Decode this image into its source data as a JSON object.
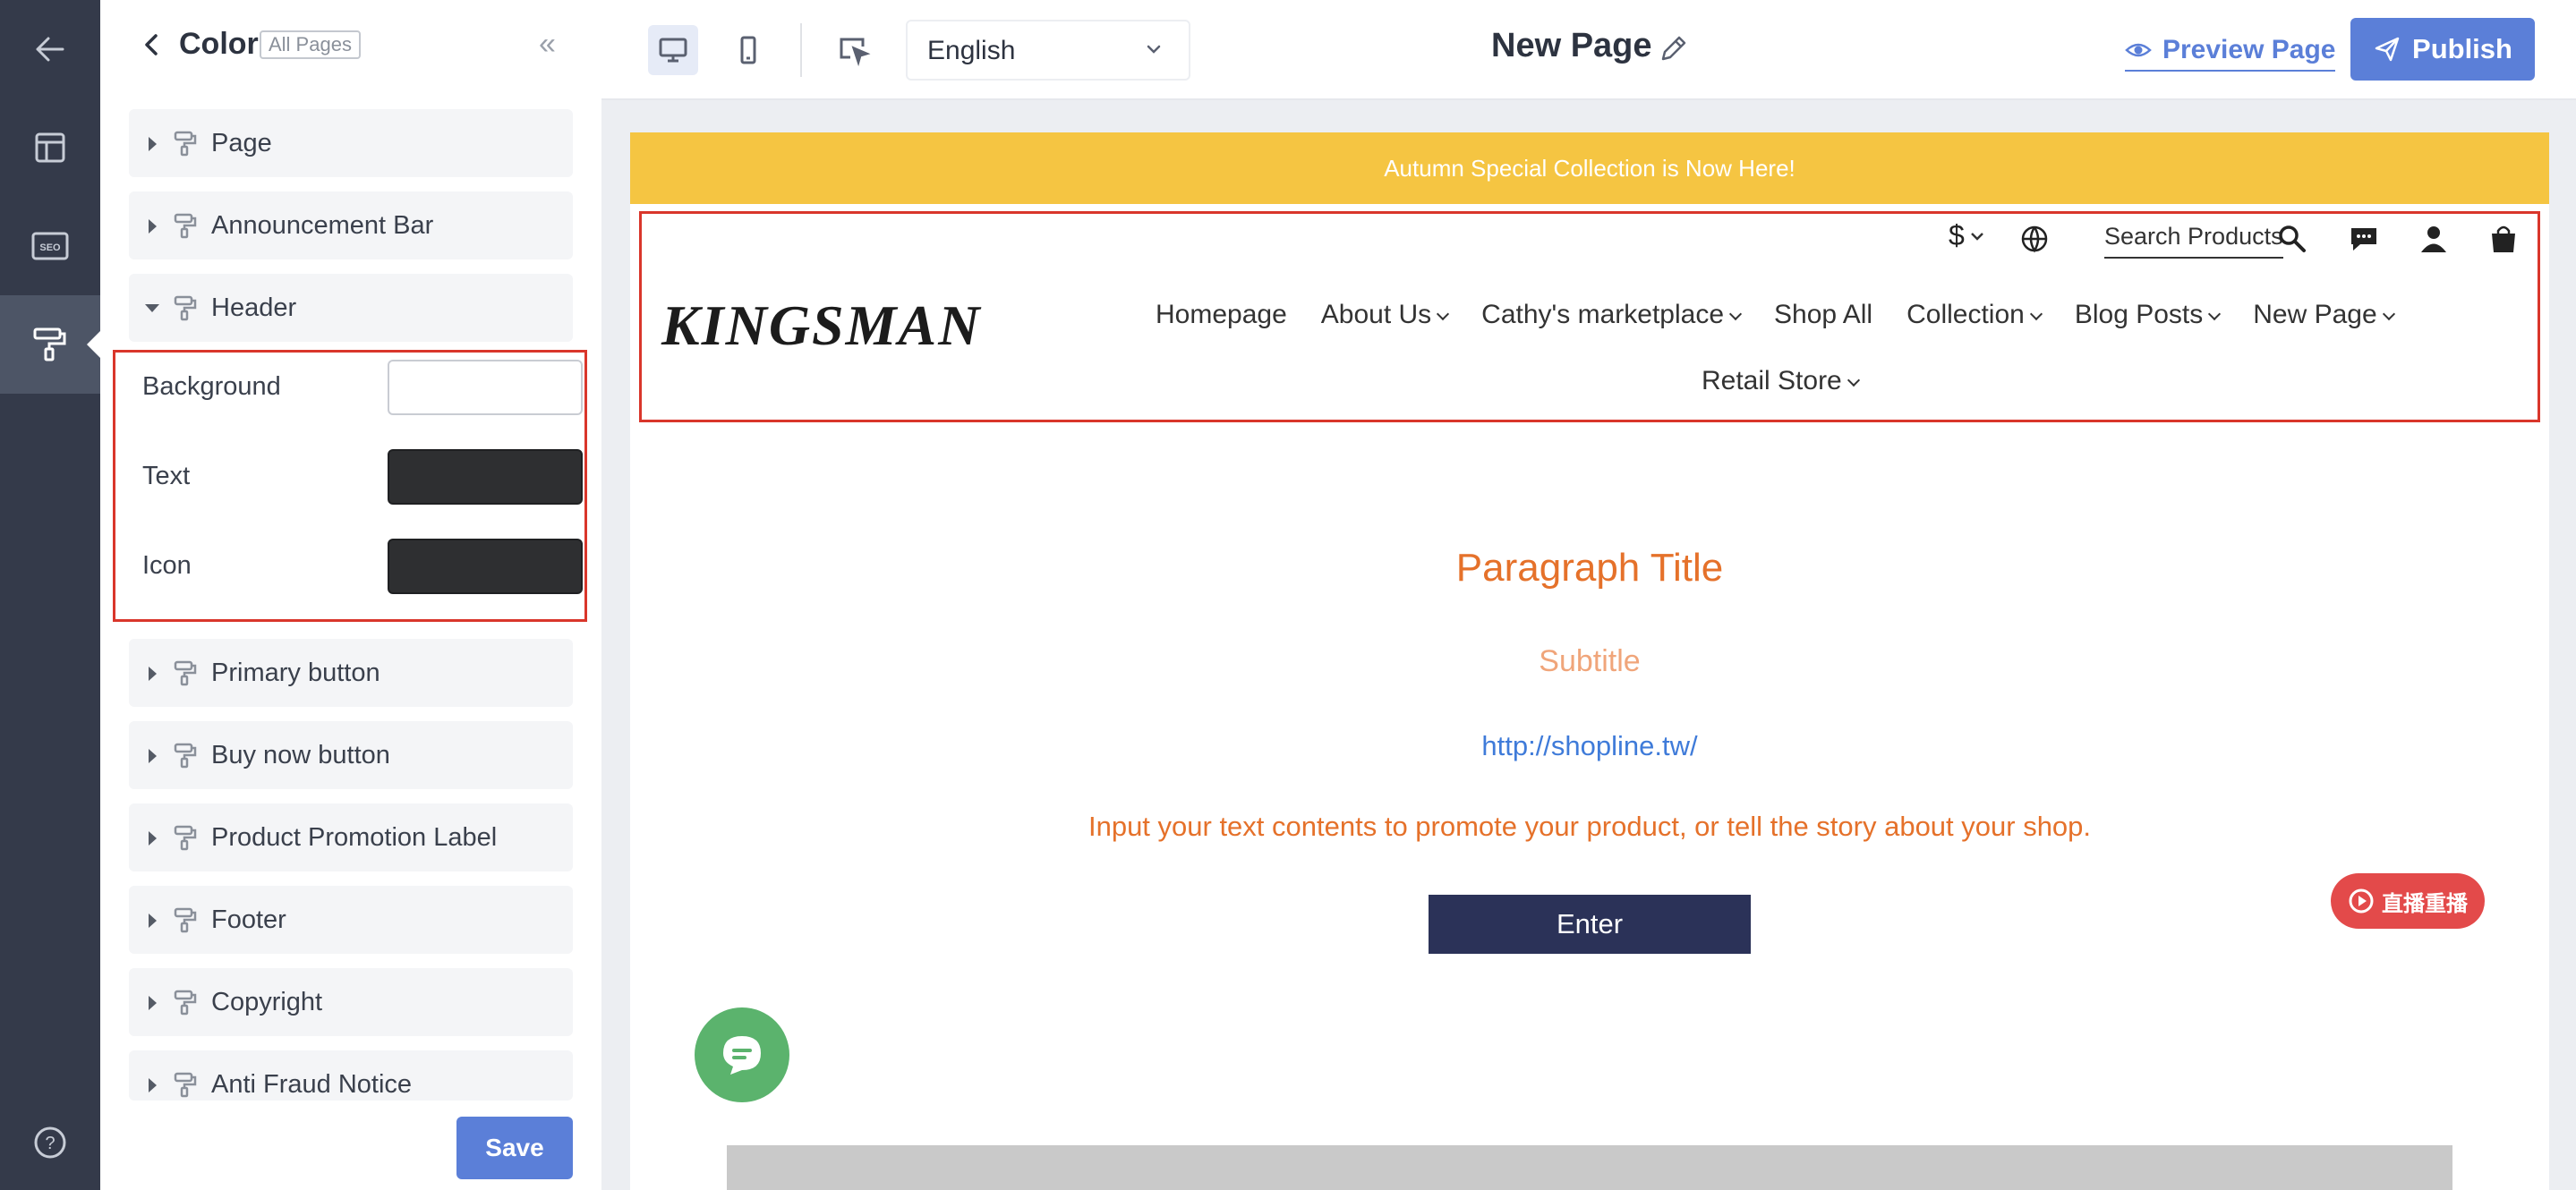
{
  "rail": {
    "items": [
      {
        "icon": "arrow-left-icon"
      },
      {
        "icon": "layout-icon"
      },
      {
        "icon": "seo-icon",
        "label": "SEO"
      },
      {
        "icon": "paint-roller-icon"
      },
      {
        "icon": "help-icon",
        "label": "?"
      }
    ]
  },
  "panel": {
    "title": "Color",
    "badge": "All Pages",
    "sections_top": [
      {
        "label": "Page"
      },
      {
        "label": "Announcement Bar"
      }
    ],
    "header_section": {
      "label": "Header",
      "rows": [
        {
          "label": "Background",
          "color": "#ffffff"
        },
        {
          "label": "Text",
          "color": "#2e2f31"
        },
        {
          "label": "Icon",
          "color": "#2e2f31"
        }
      ]
    },
    "sections_bottom": [
      {
        "label": "Primary button"
      },
      {
        "label": "Buy now button"
      },
      {
        "label": "Product Promotion Label"
      },
      {
        "label": "Footer"
      },
      {
        "label": "Copyright"
      },
      {
        "label": "Anti Fraud Notice"
      }
    ],
    "save_label": "Save"
  },
  "topbar": {
    "language": "English",
    "page_name": "New Page",
    "preview_label": "Preview Page",
    "publish_label": "Publish"
  },
  "site": {
    "announcement": "Autumn Special Collection is Now Here!",
    "logo": "KINGSMAN",
    "currency": "$",
    "search_placeholder": "Search Products",
    "nav": [
      {
        "label": "Homepage",
        "dropdown": false
      },
      {
        "label": "About Us",
        "dropdown": true
      },
      {
        "label": "Cathy's marketplace",
        "dropdown": true
      },
      {
        "label": "Shop All",
        "dropdown": false
      },
      {
        "label": "Collection",
        "dropdown": true
      },
      {
        "label": "Blog Posts",
        "dropdown": true
      },
      {
        "label": "New Page",
        "dropdown": true
      }
    ],
    "nav_row2": [
      {
        "label": "Retail Store",
        "dropdown": true
      }
    ],
    "paragraph_title": "Paragraph Title",
    "subtitle": "Subtitle",
    "link": "http://shopline.tw/",
    "body": "Input your text contents to promote your product, or tell the story about your shop.",
    "button_label": "Enter",
    "live_badge": "直播重播"
  },
  "colors": {
    "accent": "#5b7fd8",
    "announcement_bg": "#f5c542",
    "highlight": "#d9362b",
    "title_orange": "#e5712a",
    "button_navy": "#2b3258"
  }
}
